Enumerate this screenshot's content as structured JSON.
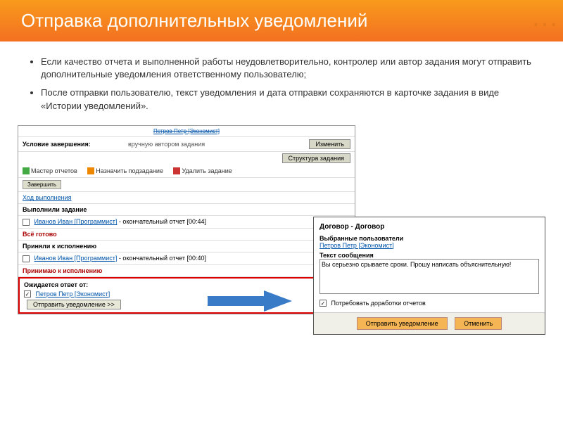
{
  "header": {
    "title": "Отправка дополнительных уведомлений"
  },
  "bullets": [
    "Если качество отчета и выполненной работы неудовлетворительно, контролер или автор задания могут отправить дополнительные уведомления ответственному пользователю;",
    "После отправки пользователю, текст уведомления и дата отправки сохраняются в карточке задания в виде «Истории уведомлений»."
  ],
  "panel1": {
    "truncated_user": "Петров Петр [Экономист]",
    "cond_label": "Условие завершения:",
    "cond_value": "вручную автором задания",
    "btn_change": "Изменить",
    "btn_struct": "Структура задания",
    "tool_reports": "Мастер отчетов",
    "tool_subtask": "Назначить подзадание",
    "tool_delete": "Удалить задание",
    "tab_finish": "Завершить",
    "progress": "Ход выполнения",
    "completed_header": "Выполнили задание",
    "row1_user": "Иванов Иван [Программист]",
    "row1_tail": " - окончательный отчет [00:44]",
    "all_ready": "Всё готово",
    "accepted_header": "Приняли к исполнению",
    "row2_tail": " - окончательный отчет [00:40]",
    "accept": "Принимаю к исполнению",
    "awaiting": "Ожидается ответ от:",
    "awaiting_user": "Петров Петр [Экономист]",
    "send_btn": "Отправить уведомление >>"
  },
  "panel2": {
    "title": "Договор - Договор",
    "sel_users": "Выбранные пользователи",
    "user": "Петров Петр [Экономист]",
    "msg_label": "Текст сообщения",
    "msg_text": "Вы серьезно срываете сроки. Прошу написать объяснительную!",
    "require_rework": "Потребовать доработки отчетов",
    "btn_send": "Отправить уведомление",
    "btn_cancel": "Отменить"
  },
  "colors": {
    "accent": "#f37021"
  }
}
